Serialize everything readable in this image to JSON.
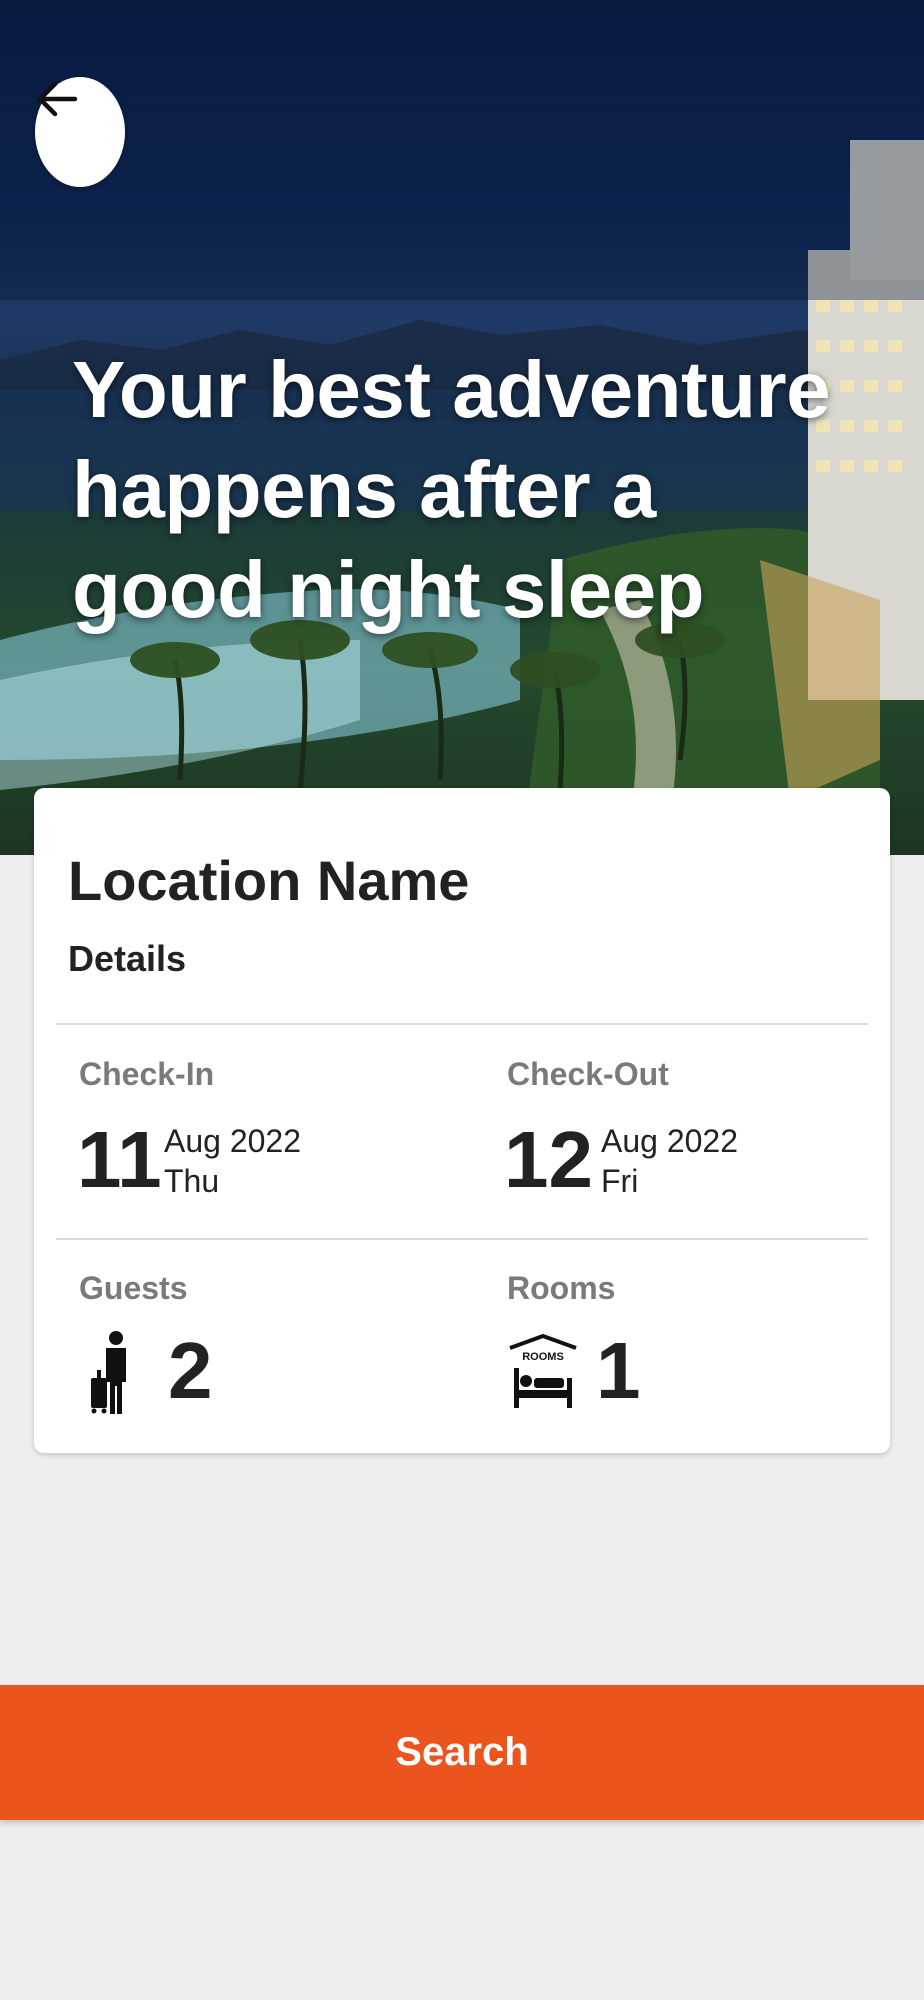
{
  "hero": {
    "headline": "Your best adventure happens after a good night sleep"
  },
  "icons": {
    "back": "arrow-left-icon",
    "guests": "traveler-luggage-icon",
    "rooms": "rooms-bed-icon"
  },
  "card": {
    "location_name": "Location Name",
    "details_label": "Details",
    "check_in": {
      "label": "Check-In",
      "day": "11",
      "month_year": "Aug 2022",
      "weekday": "Thu"
    },
    "check_out": {
      "label": "Check-Out",
      "day": "12",
      "month_year": "Aug 2022",
      "weekday": "Fri"
    },
    "guests": {
      "label": "Guests",
      "count": "2"
    },
    "rooms": {
      "label": "Rooms",
      "count": "1",
      "sign_text": "ROOMS"
    }
  },
  "actions": {
    "search_label": "Search"
  },
  "colors": {
    "accent": "#ec541e",
    "background": "#eeeeee",
    "card": "#ffffff"
  }
}
